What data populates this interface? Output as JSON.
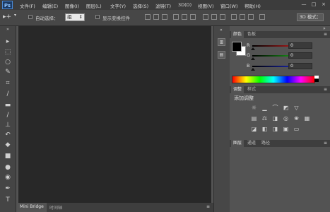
{
  "app": {
    "logo": "Ps"
  },
  "menubar": {
    "items": [
      "文件(F)",
      "编辑(E)",
      "图像(I)",
      "图层(L)",
      "文字(Y)",
      "选择(S)",
      "滤镜(T)",
      "3D(D)",
      "视图(V)",
      "窗口(W)",
      "帮助(H)"
    ],
    "window_controls": [
      "—",
      "□",
      "×"
    ]
  },
  "options_bar": {
    "auto_select_label": "自动选择：",
    "auto_select_value": "组",
    "show_transform_label": "显示变换控件",
    "mode_3d_label": "3D 模式："
  },
  "tools": [
    "move-tool-icon",
    "marquee-tool-icon",
    "lasso-tool-icon",
    "quick-select-tool-icon",
    "crop-tool-icon",
    "eyedropper-tool-icon",
    "healing-brush-tool-icon",
    "brush-tool-icon",
    "clone-stamp-tool-icon",
    "history-brush-tool-icon",
    "eraser-tool-icon",
    "gradient-tool-icon",
    "blur-tool-icon",
    "dodge-tool-icon",
    "pen-tool-icon",
    "type-tool-icon"
  ],
  "bottom_tabs": [
    "Mini Bridge",
    "时间轴"
  ],
  "color_panel": {
    "tabs": [
      "颜色",
      "色板"
    ],
    "channels": [
      {
        "label": "R",
        "value": "0",
        "color": "#d23a3a"
      },
      {
        "label": "G",
        "value": "0",
        "color": "#3aa03a"
      },
      {
        "label": "B",
        "value": "0",
        "color": "#3a3ad2"
      }
    ]
  },
  "adjustments_panel": {
    "tabs": [
      "调整",
      "样式"
    ],
    "title": "添加调整"
  },
  "layers_panel": {
    "tabs": [
      "图层",
      "通道",
      "路径"
    ]
  }
}
